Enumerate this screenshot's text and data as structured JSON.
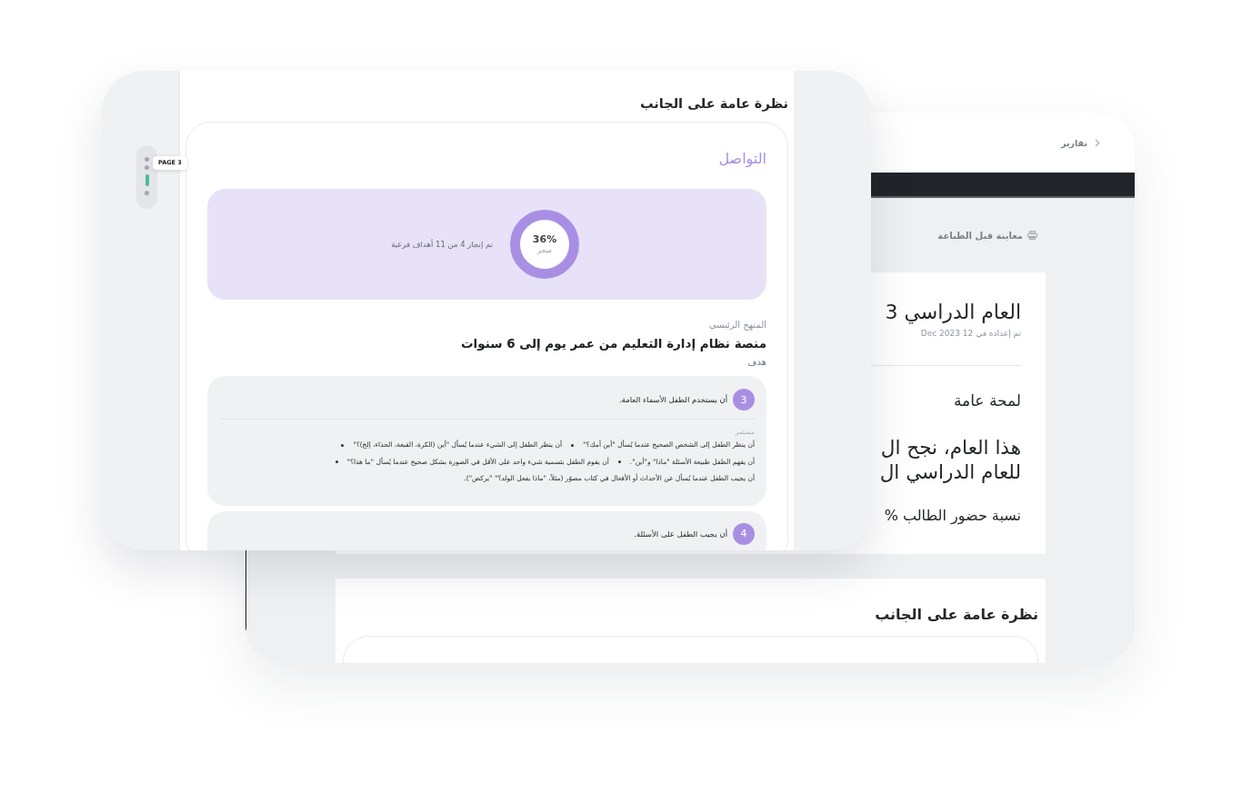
{
  "front_window": {
    "page_indicator": {
      "pages": [
        {
          "selected": false
        },
        {
          "selected": false
        },
        {
          "selected": true
        },
        {
          "selected": false
        }
      ],
      "tooltip": "PAGE 3"
    },
    "title": "نظرة عامة على الجانب",
    "domain": {
      "title": "التواصل",
      "progress": {
        "percent": "36%",
        "label": "منجز",
        "summary": "تم إنجاز 4 من 11 أهداف فرعية"
      },
      "curriculum_label": "المنهج الرئيسي",
      "curriculum": "منصة نظام إدارة التعليم من عمر يوم إلى 6 سنوات",
      "goal_label": "هدف",
      "goals": [
        {
          "number": "3",
          "title": "أن يستخدم الطفل الأسماء العامة.",
          "status": "مستمر",
          "lines": [
            [
              {
                "text": "أن ينظر الطفل إلى الشخص الصحيح عندما يُسأل \"أين أمك؟\"",
                "bullet": true
              },
              {
                "text": "أن ينظر الطفل إلى الشيء عندما يُسأل \"أين (الكرة، القبعة، الحذاء، إلخ)؟\"",
                "bullet": true
              }
            ],
            [
              {
                "text": "أن يفهم الطفل طبيعة الأسئلة \"ماذا\" و\"أين\".",
                "bullet": true
              },
              {
                "text": "أن يقوم الطفل بتسمية شيء واحد على الأقل في الصورة بشكل صحيح عندما يُسأل \"ما هذا؟\"",
                "bullet": true
              }
            ],
            [
              {
                "text": "أن يجيب الطفل عندما يُسأل عن الأحداث أو الأفعال في كتاب مصوّر (مثلاً، \"ماذا يفعل الولد؟\" \"يركض\").",
                "bullet": false
              }
            ]
          ]
        },
        {
          "number": "4",
          "title": "أن يجيب الطفل على الأسئلة."
        }
      ]
    }
  },
  "back_window": {
    "breadcrumb": "تقارير",
    "print_preview": "معاينة قبل الطباعة",
    "report": {
      "title": "العام الدراسي 3",
      "prepared": "تم إعداده في 12 Dec 2023",
      "section": "لمحة عامة",
      "headline_lines": [
        "هذا العام، نجح ال",
        "للعام الدراسي ال"
      ],
      "attendance": "نسبة حضور الطالب %"
    },
    "next_page": {
      "title": "نظرة عامة على الجانب"
    }
  }
}
